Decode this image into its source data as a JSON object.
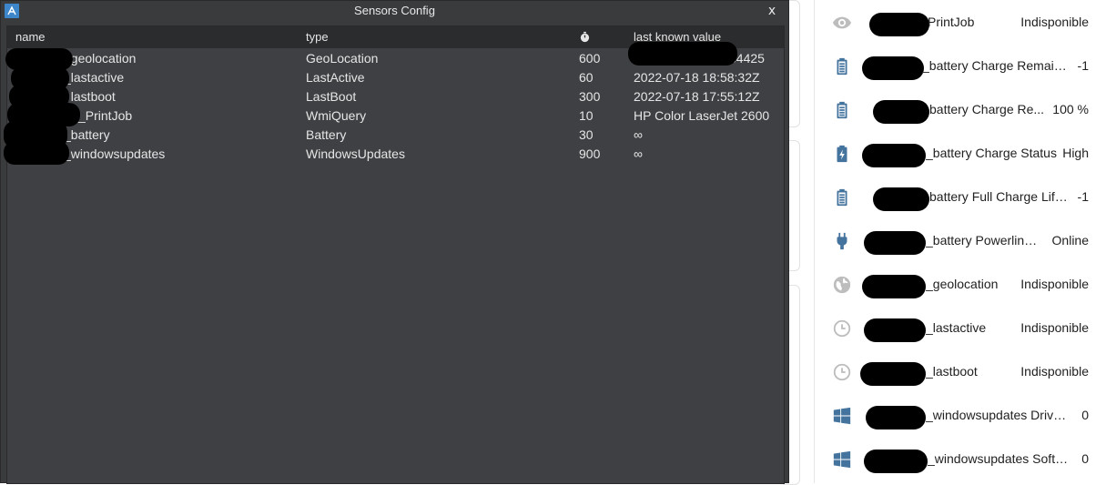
{
  "dialog": {
    "title": "Sensors Config",
    "close_label": "x",
    "columns": {
      "name": "name",
      "type": "type",
      "value": "last known value"
    },
    "rows": [
      {
        "name": "_geolocation",
        "type": "GeoLocation",
        "interval": "600",
        "value": "34425"
      },
      {
        "name": "_lastactive",
        "type": "LastActive",
        "interval": "60",
        "value": "2022-07-18 18:58:32Z"
      },
      {
        "name": "_lastboot",
        "type": "LastBoot",
        "interval": "300",
        "value": "2022-07-18 17:55:12Z"
      },
      {
        "name": "_PrintJob",
        "type": "WmiQuery",
        "interval": "10",
        "value": "HP Color LaserJet 2600"
      },
      {
        "name": "_battery",
        "type": "Battery",
        "interval": "30",
        "value": "∞"
      },
      {
        "name": "_windowsupdates",
        "type": "WindowsUpdates",
        "interval": "900",
        "value": "∞"
      }
    ]
  },
  "right_panel": {
    "items": [
      {
        "icon": "eye-icon",
        "name": "PrintJob",
        "value": "Indisponible"
      },
      {
        "icon": "battery-icon",
        "name": "_battery Charge Remaini...",
        "value": "-1"
      },
      {
        "icon": "battery-icon",
        "name": "battery Charge Re...",
        "value": "100 %"
      },
      {
        "icon": "battery-charging-icon",
        "name": "_battery Charge Status",
        "value": "High"
      },
      {
        "icon": "battery-icon",
        "name": "battery Full Charge Life...",
        "value": "-1"
      },
      {
        "icon": "power-plug-icon",
        "name": "_battery Powerline ...",
        "value": "Online"
      },
      {
        "icon": "globe-icon",
        "name": "_geolocation",
        "value": "Indisponible"
      },
      {
        "icon": "clock-icon",
        "name": "_lastactive",
        "value": "Indisponible"
      },
      {
        "icon": "clock-icon",
        "name": "_lastboot",
        "value": "Indisponible"
      },
      {
        "icon": "windows-icon",
        "name": "_windowsupdates Driver ...",
        "value": "0"
      },
      {
        "icon": "windows-icon",
        "name": "_windowsupdates Softw...",
        "value": "0"
      }
    ]
  },
  "colors": {
    "dialog_bg": "#3a3b3d",
    "header_bg": "#2b2c2e",
    "icon_blue": "#44739e",
    "icon_grey": "#bdbdbd"
  }
}
